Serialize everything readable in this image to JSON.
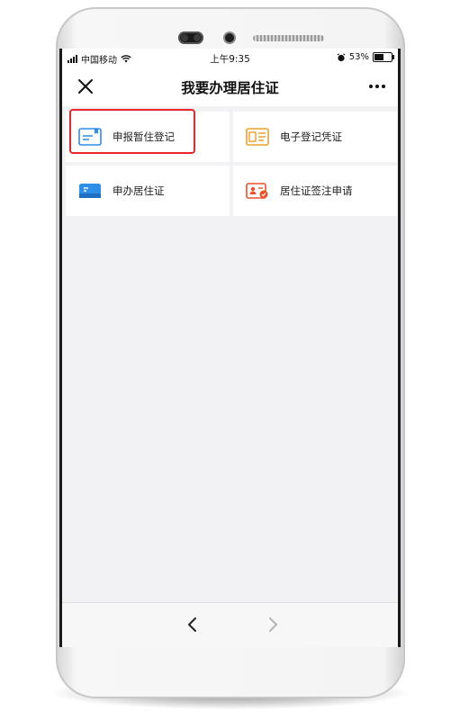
{
  "status_bar": {
    "carrier": "中国移动",
    "time": "上午9:35",
    "battery_percent": "53%",
    "battery_level": 0.53
  },
  "nav": {
    "title": "我要办理居住证"
  },
  "services": [
    {
      "label": "申报暂住登记",
      "icon": "id-card-icon",
      "color": "#2f8ee8",
      "highlighted": true
    },
    {
      "label": "电子登记凭证",
      "icon": "certificate-icon",
      "color": "#f0a02c"
    },
    {
      "label": "申办居住证",
      "icon": "card-icon",
      "color": "#2f8ee8"
    },
    {
      "label": "居住证签注申请",
      "icon": "badge-stamp-icon",
      "color": "#e8512b"
    }
  ],
  "colors": {
    "highlight_border": "#e8262b",
    "screen_bg": "#f2f2f4"
  }
}
